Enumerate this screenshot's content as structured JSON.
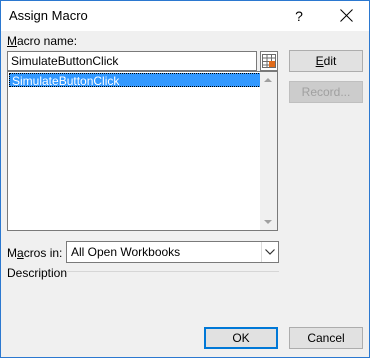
{
  "window": {
    "title": "Assign Macro",
    "help": "?"
  },
  "macro_name": {
    "label_prefix": "",
    "label_mnemonic": "M",
    "label_rest": "acro name:",
    "value": "SimulateButtonClick"
  },
  "macro_list": {
    "items": [
      "SimulateButtonClick"
    ],
    "selected": 0
  },
  "buttons": {
    "edit_mnemonic": "E",
    "edit_rest": "dit",
    "record": "Record...",
    "ok": "OK",
    "cancel": "Cancel"
  },
  "macros_in": {
    "label_pre": "M",
    "label_mnemonic": "a",
    "label_rest": "cros in:",
    "value": "All Open Workbooks"
  },
  "description": {
    "label": "Description"
  },
  "colors": {
    "selection": "#3399ff",
    "accent": "#0078d7"
  }
}
